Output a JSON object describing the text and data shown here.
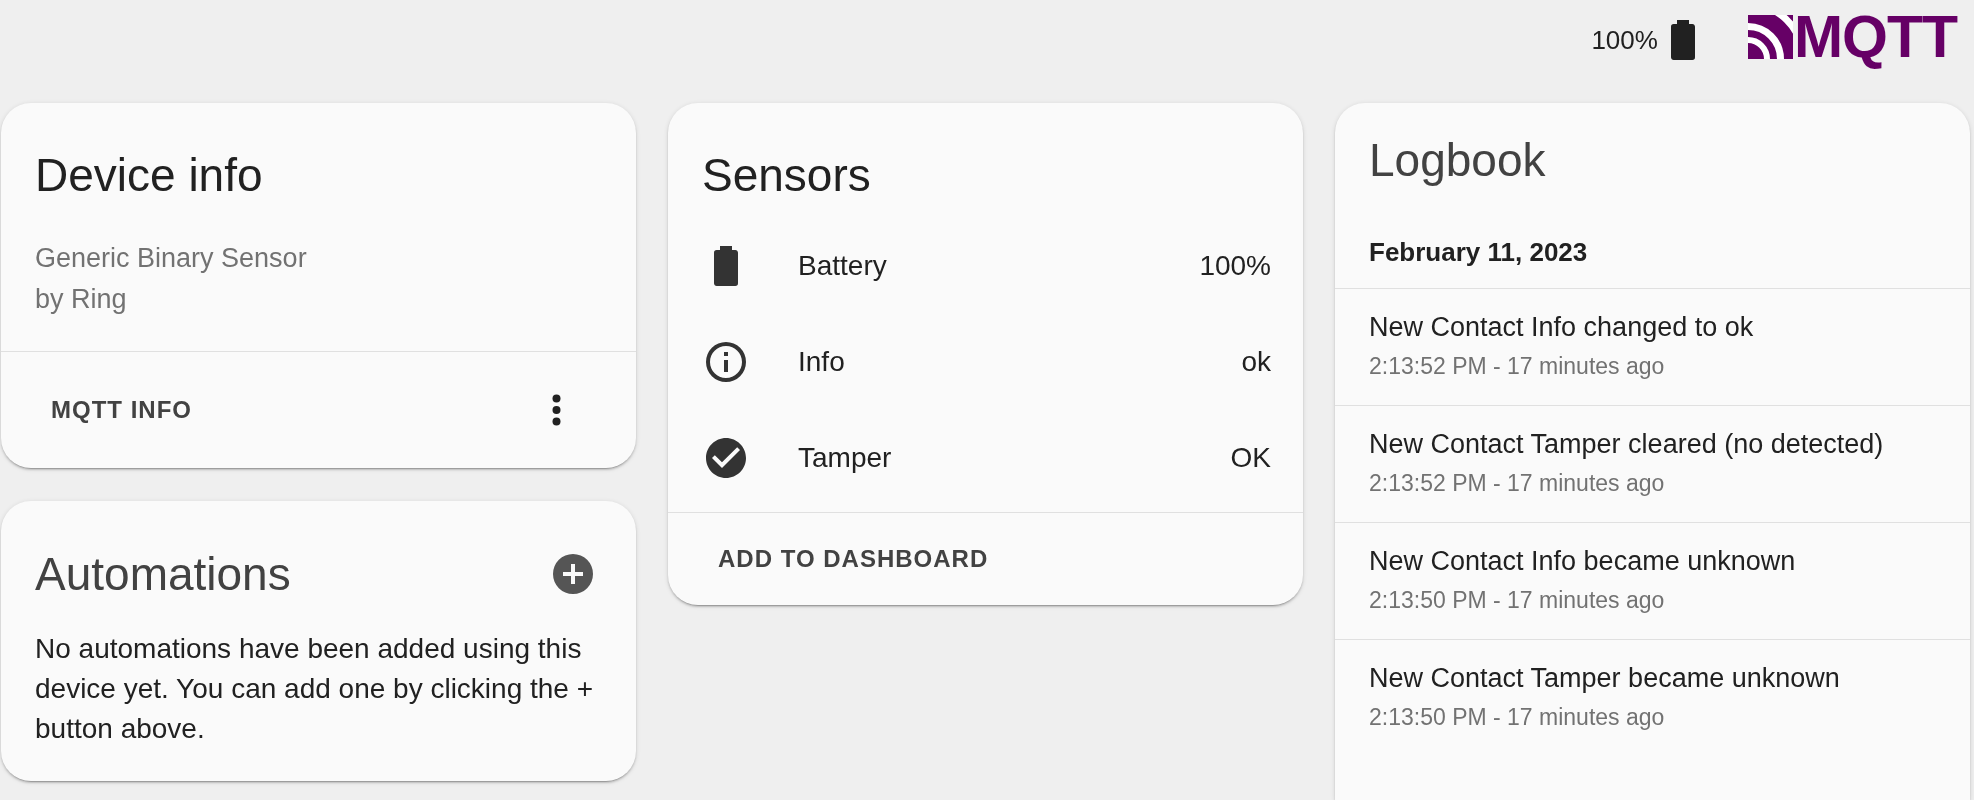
{
  "header": {
    "battery": "100%",
    "logo": "MQTT"
  },
  "device_info": {
    "title": "Device info",
    "model": "Generic Binary Sensor",
    "manufacturer": "by Ring",
    "action": "MQTT INFO"
  },
  "automations": {
    "title": "Automations",
    "message": "No automations have been added using this device yet. You can add one by clicking the + button above."
  },
  "sensors": {
    "title": "Sensors",
    "rows": [
      {
        "kind": "battery",
        "name": "Battery",
        "value": "100%"
      },
      {
        "kind": "text",
        "name": "Info",
        "value": "ok"
      },
      {
        "kind": "binary",
        "name": "Tamper",
        "value": "OK"
      }
    ],
    "action": "ADD TO DASHBOARD"
  },
  "logbook": {
    "title": "Logbook",
    "date": "February 11, 2023",
    "entries": [
      {
        "message": "New Contact Info changed to ok",
        "time": "2:13:52 PM - 17 minutes ago"
      },
      {
        "message": "New Contact Tamper cleared (no detected)",
        "time": "2:13:52 PM - 17 minutes ago"
      },
      {
        "message": "New Contact Info became unknown",
        "time": "2:13:50 PM - 17 minutes ago"
      },
      {
        "message": "New Contact Tamper became unknown",
        "time": "2:13:50 PM - 17 minutes ago"
      }
    ]
  }
}
